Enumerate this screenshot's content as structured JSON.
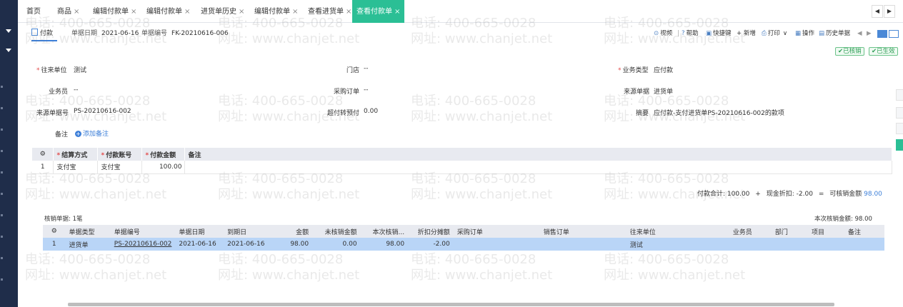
{
  "tabs": [
    {
      "label": "首页",
      "closable": false
    },
    {
      "label": "商品",
      "closable": true
    },
    {
      "label": "编辑付款单",
      "closable": true
    },
    {
      "label": "编辑付款单",
      "closable": true
    },
    {
      "label": "进货单历史",
      "closable": true
    },
    {
      "label": "编辑付款单",
      "closable": true
    },
    {
      "label": "查看进货单",
      "closable": true
    },
    {
      "label": "查看付款单",
      "closable": true,
      "active": true
    }
  ],
  "tab_close_glyph": "×",
  "tab_nav": {
    "prev": "◀",
    "next": "▶"
  },
  "doc_tab": {
    "label": "付款"
  },
  "doc_header": {
    "date_label": "单据日期",
    "date_value": "2021-06-16",
    "number_label": "单据编号",
    "number_value": "FK-20210616-006"
  },
  "toolbar": {
    "video": "视频",
    "sep": "|",
    "help": "帮助",
    "shortcut": "快捷键",
    "new": "+ 新增",
    "print": "打印",
    "operate": "操作",
    "history": "历史单据",
    "prev": "◀",
    "next": "▶"
  },
  "status_badges": [
    "已核销",
    "已生效"
  ],
  "form": {
    "partner_label": "往来单位",
    "partner_value": "测试",
    "store_label": "门店",
    "store_value": "--",
    "biztype_label": "业务类型",
    "biztype_value": "应付款",
    "clerk_label": "业务员",
    "clerk_value": "--",
    "po_label": "采购订单",
    "po_value": "--",
    "source_type_label": "来源单据",
    "source_type_value": "进货单",
    "source_no_label": "来源单据号",
    "source_no_value": "PS-20210616-002",
    "overpay_label": "超付转预付",
    "overpay_value": "0.00",
    "summary_label": "摘要",
    "summary_value": "应付款-支付进货单PS-20210616-002的款项",
    "note_label": "备注",
    "add_note": "添加备注"
  },
  "settlement_table": {
    "headers": [
      "结算方式",
      "付款账号",
      "付款金额",
      "备注"
    ],
    "rows": [
      {
        "index": "1",
        "method": "支付宝",
        "account": "支付宝",
        "amount": "100.00",
        "note": ""
      }
    ]
  },
  "totals": {
    "pay_total_label": "付款合计:",
    "pay_total_value": "100.00",
    "plus": "+",
    "discount_label": "现金折扣:",
    "discount_value": "-2.00",
    "equals": "=",
    "writeoff_label": "可核销金额",
    "writeoff_value": "98.00"
  },
  "writeoff": {
    "count_label": "核销单据: 1笔",
    "this_amount_label": "本次核销金额: 98.00"
  },
  "writeoff_table": {
    "headers": [
      "单据类型",
      "单据编号",
      "单据日期",
      "到期日",
      "金额",
      "未核销金额",
      "本次核销...",
      "折扣分摊额",
      "采购订单",
      "销售订单",
      "往来单位",
      "业务员",
      "部门",
      "项目",
      "备注"
    ],
    "rows": [
      {
        "index": "1",
        "doc_type": "进货单",
        "doc_no": "PS-20210616-002",
        "doc_date": "2021-06-16",
        "due_date": "2021-06-16",
        "amount": "98.00",
        "unwritten": "0.00",
        "this_writeoff": "98.00",
        "discount": "-2.00",
        "po": "",
        "so": "",
        "partner": "测试",
        "clerk": "",
        "dept": "",
        "project": "",
        "note": ""
      }
    ]
  },
  "watermark": {
    "phone": "电话: 400-665-0028",
    "site": "网址: www.chanjet.net"
  },
  "icons": [
    "settings-gear-icon",
    "document-icon",
    "video-icon",
    "help-icon",
    "keyboard-icon",
    "printer-icon",
    "grid-icon",
    "history-icon",
    "list-view-icon",
    "card-view-icon",
    "plus-circle-icon"
  ],
  "colors": {
    "accent": "#2bbf95",
    "link": "#3d7fd8",
    "selected_row": "#b9d5f7",
    "sidebar": "#1f2d4a",
    "badge_green": "#2e9e56",
    "required": "#e34a4a"
  }
}
